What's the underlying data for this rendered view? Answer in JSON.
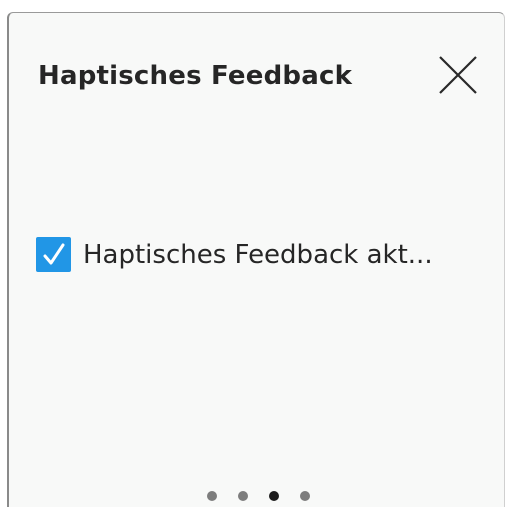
{
  "dialog": {
    "title": "Haptisches Feedback",
    "close_icon": "close-icon"
  },
  "option": {
    "label": "Haptisches Feedback akt...",
    "checked": true,
    "check_icon": "checkmark-icon"
  },
  "pager": {
    "page_count": 4,
    "active_page": 3
  },
  "colors": {
    "accent": "#2196e6",
    "text": "#262626",
    "background": "#f8f9f8"
  }
}
